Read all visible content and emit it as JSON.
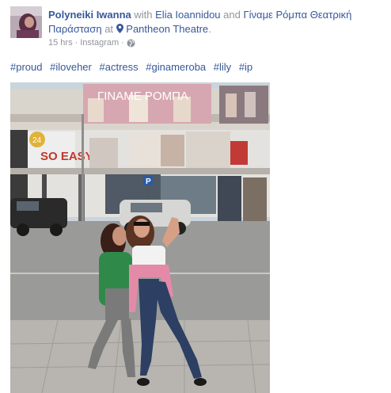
{
  "post": {
    "author": "Polyneiki Iwanna",
    "with_text": "with",
    "tagged_person": "Elia Ioannidou",
    "and_text": "and",
    "page_name": "Γίναμε Ρόμπα Θεατρική Παράσταση",
    "at_text": "at",
    "location": "Pantheon Theatre",
    "time": "15 hrs",
    "separator": "·",
    "source": "Instagram",
    "hashtags": [
      "#proud",
      "#iloveher",
      "#actress",
      "#ginameroba",
      "#lily",
      "#ip"
    ]
  },
  "photo": {
    "banner_text": "ΓΙΝΑΜΕ ΡΟΜΠΑ",
    "shop_sign": "SO EASY",
    "parking_sign": "P",
    "badge_number": "24"
  }
}
